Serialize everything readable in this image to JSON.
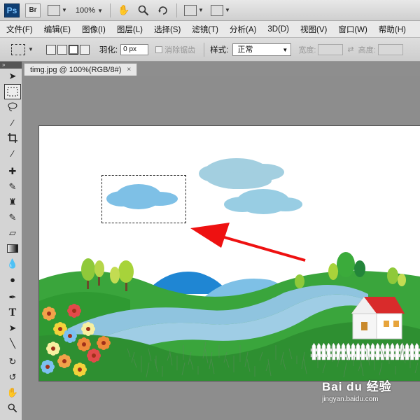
{
  "appbar": {
    "ps_logo": "Ps",
    "br_logo": "Br",
    "zoom": "100%"
  },
  "menu": [
    "文件(F)",
    "编辑(E)",
    "图像(I)",
    "图层(L)",
    "选择(S)",
    "滤镜(T)",
    "分析(A)",
    "3D(D)",
    "视图(V)",
    "窗口(W)",
    "帮助(H)"
  ],
  "options": {
    "feather_label": "羽化:",
    "feather_value": "0 px",
    "antialias_label": "消除锯齿",
    "style_label": "样式:",
    "style_value": "正常",
    "width_label": "宽度:",
    "height_label": "高度:"
  },
  "toolbox": {
    "collapse": "»"
  },
  "document": {
    "tab_title": "timg.jpg @ 100%(RGB/8#)",
    "close": "×"
  },
  "watermark": {
    "brand": "Bai du 经验",
    "url": "jingyan.baidu.com"
  },
  "colors": {
    "sky_cloud": "#9fcfe3",
    "selected_cloud": "#7ec0e6",
    "grass": "#2f9a32",
    "river": "#8fc4df",
    "house_roof": "#d92b2b",
    "arrow": "#ee1111"
  }
}
